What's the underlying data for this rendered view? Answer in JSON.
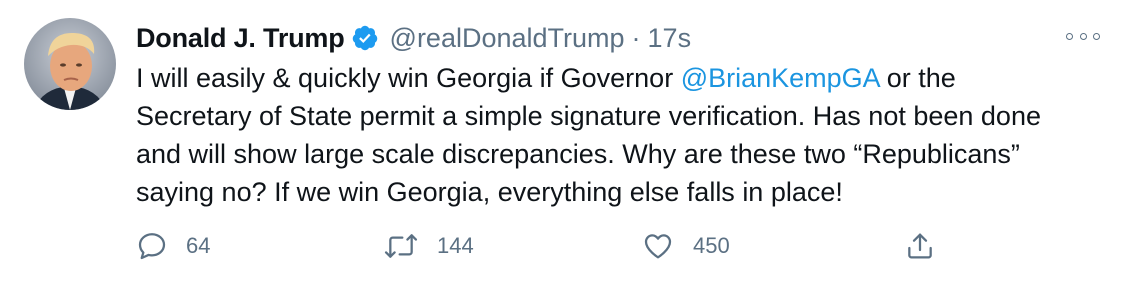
{
  "author": {
    "name": "Donald J. Trump",
    "handle": "@realDonaldTrump",
    "separator": "·",
    "time": "17s",
    "verified": true
  },
  "tweet": {
    "lines": [
      {
        "pre": "I will easily & quickly win Georgia if Governor ",
        "mention": "@BrianKempGA",
        "post": " or the"
      },
      {
        "text": "Secretary of State permit a simple signature verification. Has not been done"
      },
      {
        "text": "and will show large scale discrepancies. Why are these two “Republicans”"
      },
      {
        "text": "saying no? If we win Georgia, everything else falls in place!"
      }
    ]
  },
  "actions": {
    "reply_count": "64",
    "retweet_count": "144",
    "like_count": "450"
  },
  "icons": {
    "more": "more-horizontal-icon",
    "reply": "comment-bubble-icon",
    "retweet": "retweet-arrows-icon",
    "like": "heart-icon",
    "share": "share-upload-icon",
    "verified": "verified-badge-icon"
  },
  "colors": {
    "mention": "#1b95e0",
    "secondary_text": "#5b7083",
    "verified_badge": "#1d9bf0",
    "primary_text": "#0f1419"
  }
}
